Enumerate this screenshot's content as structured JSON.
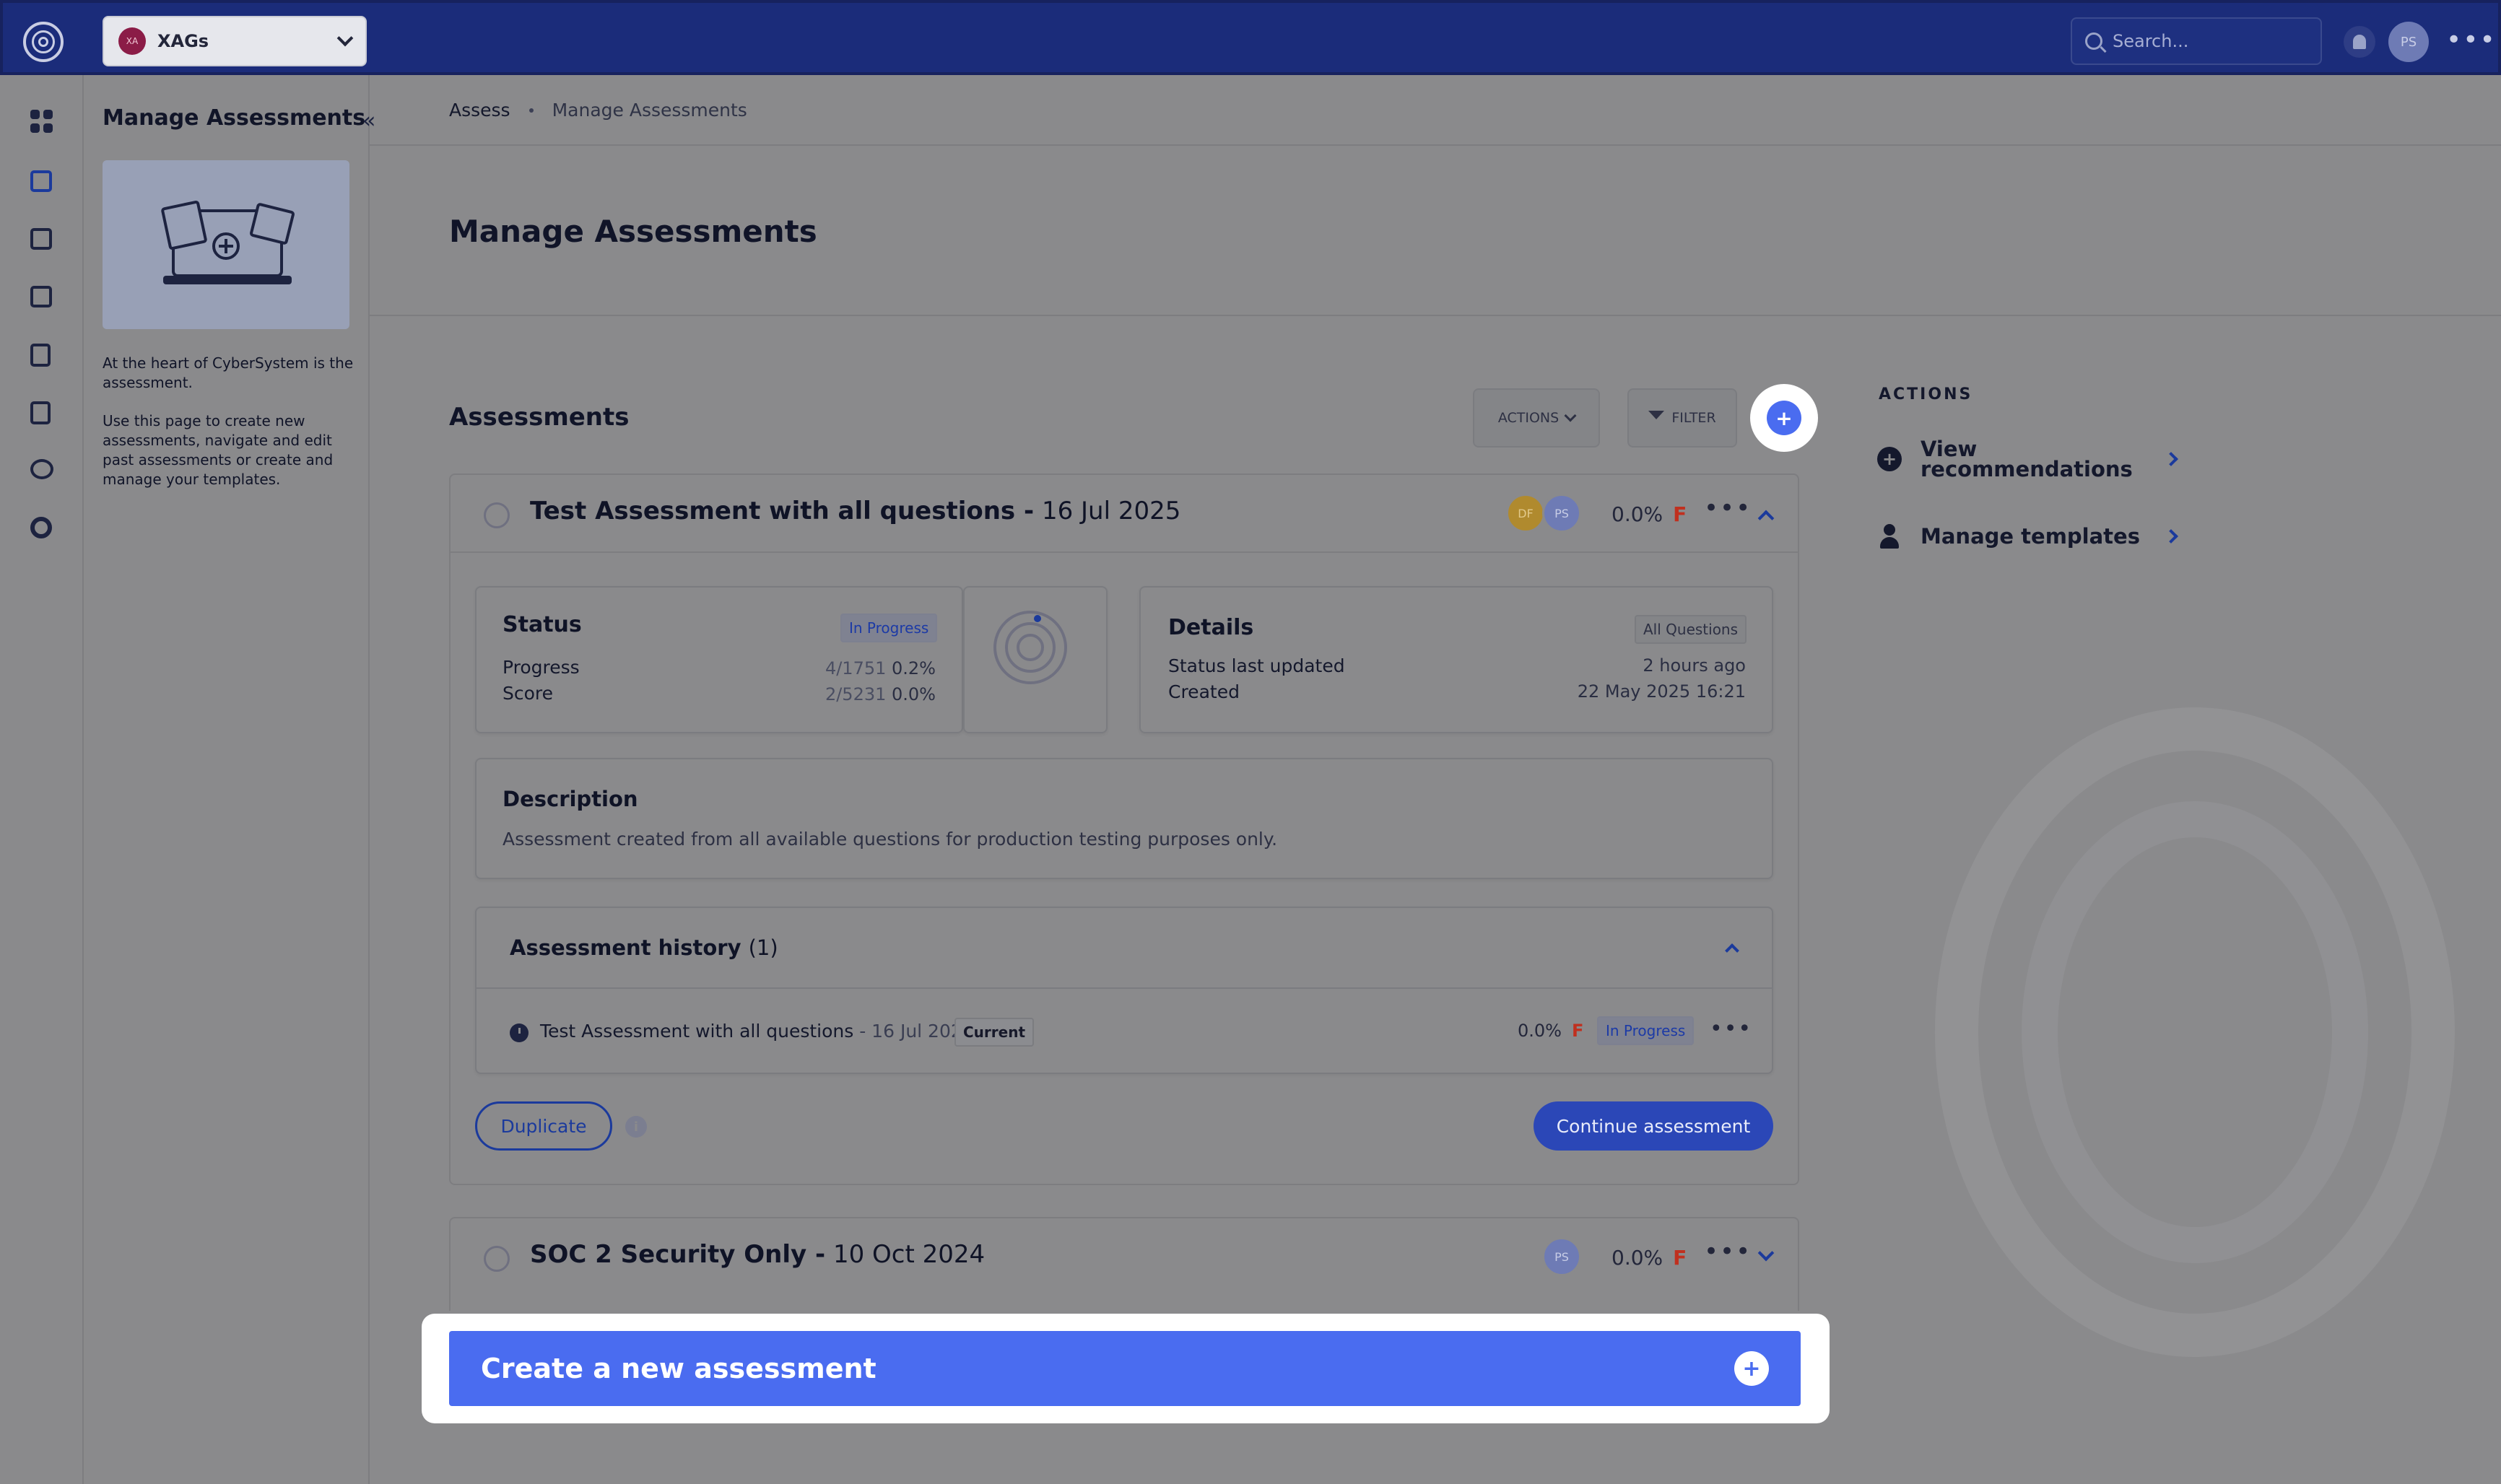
{
  "org": {
    "initials": "XA",
    "name": "XAGs"
  },
  "search": {
    "placeholder": "Search..."
  },
  "user": {
    "initials": "PS"
  },
  "side_panel": {
    "title": "Manage Assessments",
    "text1": "At the heart of CyberSystem is the assessment.",
    "text2": "Use this page to create new assessments, navigate and edit past assessments or create and manage your templates."
  },
  "breadcrumb": {
    "parent": "Assess",
    "current": "Manage Assessments"
  },
  "page_title": "Manage Assessments",
  "assessments": {
    "title": "Assessments",
    "actions_label": "ACTIONS",
    "filter_label": "FILTER"
  },
  "assessment1": {
    "name": "Test Assessment with all questions -",
    "date": "16 Jul 2025",
    "avatars": [
      "DF",
      "PS"
    ],
    "score": "0.0%",
    "grade": "F",
    "status": {
      "label": "Status",
      "tag": "In Progress",
      "progress_label": "Progress",
      "progress_count": "4/1751",
      "progress_pct": "0.2%",
      "score_label": "Score",
      "score_count": "2/5231",
      "score_pct": "0.0%"
    },
    "details": {
      "label": "Details",
      "tag": "All Questions",
      "updated_label": "Status last updated",
      "updated_value": "2 hours ago",
      "created_label": "Created",
      "created_value": "22 May 2025 16:21"
    },
    "description": {
      "label": "Description",
      "text": "Assessment created from all available questions for production testing purposes only."
    },
    "history": {
      "label": "Assessment history",
      "count": "(1)",
      "entry_name": "Test Assessment with all questions",
      "entry_date": "- 16 Jul 2025",
      "entry_tag": "Current",
      "entry_score": "0.0%",
      "entry_grade": "F",
      "entry_status": "In Progress"
    },
    "duplicate_label": "Duplicate",
    "continue_label": "Continue assessment"
  },
  "assessment2": {
    "name": "SOC 2 Security Only -",
    "date": "10 Oct 2024",
    "avatars": [
      "PS"
    ],
    "score": "0.0%",
    "grade": "F"
  },
  "cta": {
    "label": "Create a new assessment"
  },
  "actions_panel": {
    "title": "ACTIONS",
    "items": [
      {
        "label": "View recommendations"
      },
      {
        "label": "Manage templates"
      }
    ]
  },
  "colors": {
    "topbar": "#1b2c7a",
    "accent": "#4a6cf0",
    "primary_button": "#2b47b7",
    "grade_fail": "#c0301f"
  }
}
